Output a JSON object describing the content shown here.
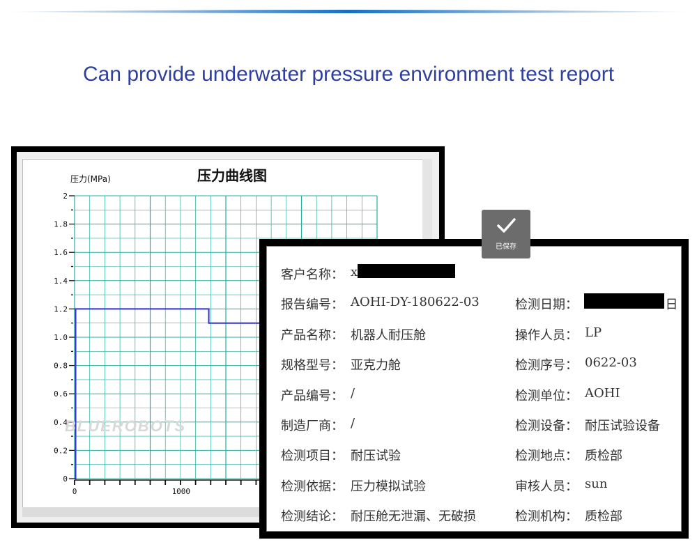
{
  "heading": "Can provide underwater pressure environment test report",
  "chart": {
    "title": "压力曲线图",
    "watermark": "BLUEROBOTS",
    "colors": {
      "grid": "#20b0a0",
      "line": "#3030d0"
    }
  },
  "chart_data": {
    "type": "line",
    "title": "压力曲线图",
    "ylabel": "压力(MPa)",
    "xlabel": "",
    "ylim": [
      0,
      2
    ],
    "yticks": [
      "2",
      "1.8",
      "1.6",
      "1.4",
      "1.2",
      "1.0",
      "0.8",
      "0.6",
      "0.4",
      "0.2",
      "0"
    ],
    "xticks": [
      "0",
      "1000"
    ],
    "series": [
      {
        "values": [
          [
            0,
            0
          ],
          [
            10,
            1.2
          ],
          [
            1250,
            1.2
          ],
          [
            1260,
            1.1
          ],
          [
            1920,
            1.1
          ]
        ]
      }
    ]
  },
  "saved_badge": {
    "label": "已保存",
    "icon": "check-icon"
  },
  "report": {
    "left": [
      {
        "label": "客户名称：",
        "value": "x"
      },
      {
        "label": "报告编号：",
        "value": "AOHI-DY-180622-03"
      },
      {
        "label": "产品名称：",
        "value": "机器人耐压舱"
      },
      {
        "label": "规格型号：",
        "value": "亚克力舱"
      },
      {
        "label": "产品编号：",
        "value": "/"
      },
      {
        "label": "制造厂商：",
        "value": "/"
      },
      {
        "label": "检测项目：",
        "value": "耐压试验"
      },
      {
        "label": "检测依据：",
        "value": "压力模拟试验"
      },
      {
        "label": "检测结论：",
        "value": "耐压舱无泄漏、无破损"
      }
    ],
    "right": [
      {
        "label": "检测日期：",
        "value": "2日"
      },
      {
        "label": "操作人员：",
        "value": "LP"
      },
      {
        "label": "检测序号：",
        "value": "0622-03"
      },
      {
        "label": "检测单位：",
        "value": "AOHI"
      },
      {
        "label": "检测设备：",
        "value": "耐压试验设备"
      },
      {
        "label": "检测地点：",
        "value": "质检部"
      },
      {
        "label": "审核人员：",
        "value": "sun"
      },
      {
        "label": "检测机构：",
        "value": "质检部"
      }
    ]
  }
}
